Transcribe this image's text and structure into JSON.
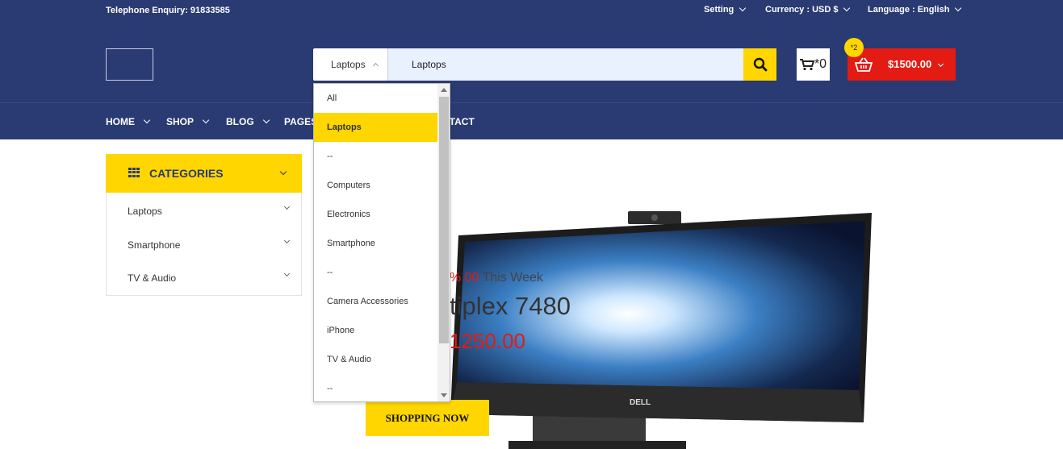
{
  "topbar": {
    "phone": "Telephone Enquiry: 91833585",
    "setting": "Setting",
    "currency": "Currency : USD $",
    "language": "Language : English"
  },
  "header": {
    "search": {
      "category": "Laptops",
      "value": "Laptops"
    },
    "compare_count": "*0",
    "cart": {
      "badge": "*2",
      "amount": "$1500.00"
    }
  },
  "nav": {
    "items": [
      "HOME",
      "SHOP",
      "BLOG",
      "PAGES",
      "CONTACT"
    ]
  },
  "categories": {
    "title": "CATEGORIES",
    "items": [
      "Laptops",
      "Smartphone",
      "TV & Audio"
    ]
  },
  "dropdown": {
    "options": [
      "All",
      "Laptops",
      "--",
      "Computers",
      "Electronics",
      "Smartphone",
      "--",
      "Camera Accessories",
      "iPhone",
      "TV & Audio",
      "--"
    ],
    "selected_index": 1
  },
  "hero": {
    "discount": "% 00",
    "discount_suffix": "This Week",
    "title": "tiplex 7480",
    "price": "1250.00",
    "button": "SHOPPING NOW",
    "brand": "DELL"
  },
  "colors": {
    "navy": "#2a3a72",
    "yellow": "#ffd600",
    "red": "#e41b13"
  }
}
